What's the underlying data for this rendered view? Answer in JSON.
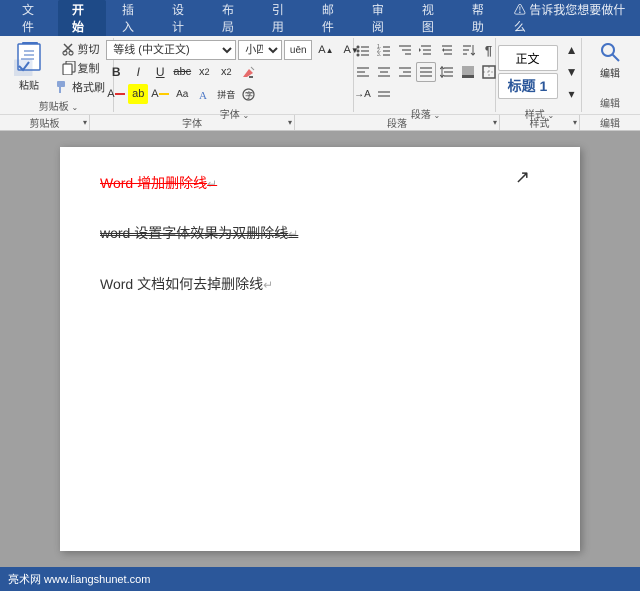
{
  "titleBar": {
    "tabs": [
      "文件",
      "开始",
      "插入",
      "设计",
      "布局",
      "引用",
      "邮件",
      "审阅",
      "视图",
      "帮助"
    ],
    "activeTab": "开始",
    "helpText": "⚠ 告诉我您想要做什么",
    "windowControls": [
      "─",
      "□",
      "✕"
    ]
  },
  "ribbon": {
    "groups": [
      {
        "name": "剪贴板",
        "label": "剪贴板"
      },
      {
        "name": "字体",
        "label": "字体",
        "fontName": "等线 (中文正文)",
        "fontSize": "小四",
        "fontSizeNum": "uēn"
      },
      {
        "name": "段落",
        "label": "段落"
      },
      {
        "name": "样式",
        "label": "样式"
      },
      {
        "name": "编辑",
        "label": "编辑"
      }
    ]
  },
  "document": {
    "lines": [
      {
        "text": "Word 增加删除线",
        "style": "strikethrough-red"
      },
      {
        "text": "word 设置字体效果为双删除线",
        "style": "double-strikethrough"
      },
      {
        "text": "Word 文档如何去掉删除线",
        "style": "normal"
      }
    ]
  },
  "statusBar": {
    "left": "亮术网 www.liangshunet.com"
  },
  "formatting": {
    "bold": "B",
    "italic": "I",
    "underline": "U",
    "strikethrough": "abc",
    "superscript": "x²",
    "subscript": "x₂",
    "clearFormat": "✕"
  }
}
